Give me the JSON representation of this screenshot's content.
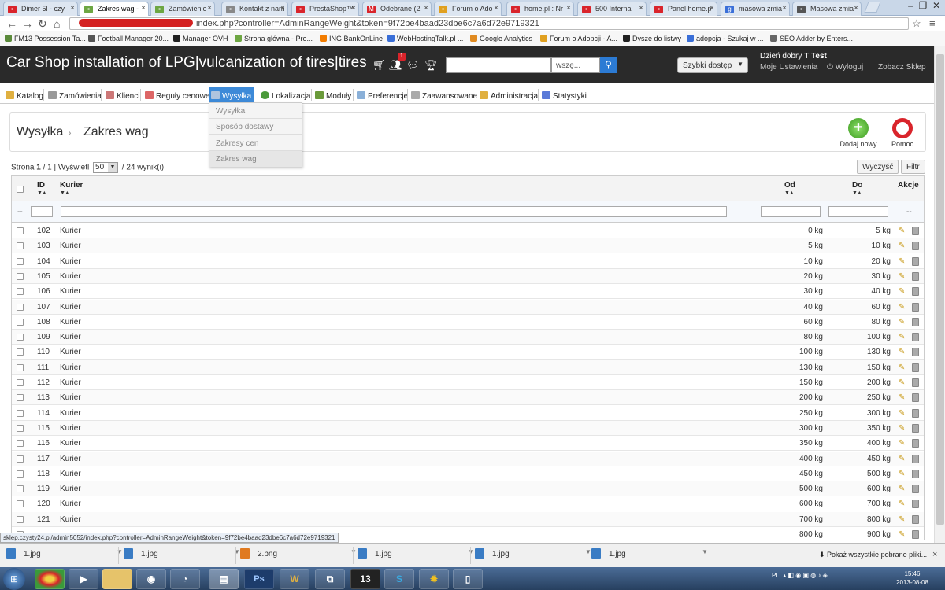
{
  "browser": {
    "tabs": [
      {
        "label": "Dimer 5l - czy",
        "color": "#d9242b"
      },
      {
        "label": "Zakres wag - ",
        "color": "#6da642"
      },
      {
        "label": "Zamówienie",
        "color": "#6da642"
      },
      {
        "label": "Kontakt z nam",
        "color": "#888888"
      },
      {
        "label": "PrestaShop™",
        "color": "#d9242b"
      },
      {
        "label": "Odebrane (2",
        "color": "#d9242b"
      },
      {
        "label": "Forum o Ado",
        "color": "#e0a020"
      },
      {
        "label": "home.pl : Nr",
        "color": "#d9242b"
      },
      {
        "label": "500 Internal",
        "color": "#d9242b"
      },
      {
        "label": "Panel home.p",
        "color": "#d9242b"
      },
      {
        "label": "masowa zmia",
        "color": "#3a6fd8"
      },
      {
        "label": "Masowa zmia",
        "color": "#555555"
      }
    ],
    "url": "index.php?controller=AdminRangeWeight&token=9f72be4baad23dbe6c7a6d72e9719321",
    "bookmarks": [
      "FM13 Possession Ta...",
      "Football Manager 20...",
      "Manager OVH",
      "Strona główna - Pre...",
      "ING BankOnLine",
      "WebHostingTalk.pl ...",
      "Google Analytics",
      "Forum o Adopcji - A...",
      "Dysze do listwy",
      "adopcja - Szukaj w ...",
      "SEO Adder by Enters..."
    ]
  },
  "header": {
    "shop_title": "Car Shop installation of LPG|vulcanization of tires|tires",
    "notification_count": "1",
    "search_placeholder": "",
    "search_scope": "wszę...",
    "quick_access": "Szybki dostęp",
    "greeting": "Dzień dobry",
    "user_name": "T Test",
    "my_settings": "Moje Ustawienia",
    "logout": "Wyloguj",
    "view_shop": "Zobacz Sklep"
  },
  "menu": {
    "items": [
      "Katalog",
      "Zamówienia",
      "Klienci",
      "Reguły cenowe",
      "Wysyłka",
      "Lokalizacja",
      "Moduły",
      "Preferencje",
      "Zaawansowane",
      "Administracja",
      "Statystyki"
    ],
    "active": "Wysyłka",
    "submenu": [
      "Wysyłka",
      "Sposób dostawy",
      "Zakresy cen",
      "Zakres wag"
    ]
  },
  "toolbar": {
    "breadcrumb_1": "Wysyłka",
    "breadcrumb_sep": "›",
    "breadcrumb_2": "Zakres wag",
    "add_new": "Dodaj nowy",
    "help": "Pomoc"
  },
  "pager": {
    "page_label": "Strona",
    "page": "1",
    "total_pages": "1",
    "show_label": "Wyświetl",
    "per_page": "50",
    "results": "/ 24 wynik(i)",
    "clear": "Wyczyść",
    "filter": "Filtr"
  },
  "grid": {
    "columns": {
      "id": "ID",
      "carrier": "Kurier",
      "from": "Od",
      "to": "Do",
      "actions": "Akcje"
    },
    "filter_dash": "--",
    "rows": [
      {
        "id": "102",
        "carrier": "Kurier",
        "from": "0 kg",
        "to": "5 kg"
      },
      {
        "id": "103",
        "carrier": "Kurier",
        "from": "5 kg",
        "to": "10 kg"
      },
      {
        "id": "104",
        "carrier": "Kurier",
        "from": "10 kg",
        "to": "20 kg"
      },
      {
        "id": "105",
        "carrier": "Kurier",
        "from": "20 kg",
        "to": "30 kg"
      },
      {
        "id": "106",
        "carrier": "Kurier",
        "from": "30 kg",
        "to": "40 kg"
      },
      {
        "id": "107",
        "carrier": "Kurier",
        "from": "40 kg",
        "to": "60 kg"
      },
      {
        "id": "108",
        "carrier": "Kurier",
        "from": "60 kg",
        "to": "80 kg"
      },
      {
        "id": "109",
        "carrier": "Kurier",
        "from": "80 kg",
        "to": "100 kg"
      },
      {
        "id": "110",
        "carrier": "Kurier",
        "from": "100 kg",
        "to": "130 kg"
      },
      {
        "id": "111",
        "carrier": "Kurier",
        "from": "130 kg",
        "to": "150 kg"
      },
      {
        "id": "112",
        "carrier": "Kurier",
        "from": "150 kg",
        "to": "200 kg"
      },
      {
        "id": "113",
        "carrier": "Kurier",
        "from": "200 kg",
        "to": "250 kg"
      },
      {
        "id": "114",
        "carrier": "Kurier",
        "from": "250 kg",
        "to": "300 kg"
      },
      {
        "id": "115",
        "carrier": "Kurier",
        "from": "300 kg",
        "to": "350 kg"
      },
      {
        "id": "116",
        "carrier": "Kurier",
        "from": "350 kg",
        "to": "400 kg"
      },
      {
        "id": "117",
        "carrier": "Kurier",
        "from": "400 kg",
        "to": "450 kg"
      },
      {
        "id": "118",
        "carrier": "Kurier",
        "from": "450 kg",
        "to": "500 kg"
      },
      {
        "id": "119",
        "carrier": "Kurier",
        "from": "500 kg",
        "to": "600 kg"
      },
      {
        "id": "120",
        "carrier": "Kurier",
        "from": "600 kg",
        "to": "700 kg"
      },
      {
        "id": "121",
        "carrier": "Kurier",
        "from": "700 kg",
        "to": "800 kg"
      },
      {
        "id": "",
        "carrier": "",
        "from": "800 kg",
        "to": "900 kg"
      }
    ]
  },
  "status_url": "sklep.czysty24.pl/admin5052/index.php?controller=AdminRangeWeight&token=9f72be4baad23dbe6c7a6d72e9719321",
  "downloads": {
    "items": [
      "1.jpg",
      "1.jpg",
      "2.png",
      "1.jpg",
      "1.jpg",
      "1.jpg"
    ],
    "show_all": "Pokaż wszystkie pobrane pliki..."
  },
  "taskbar": {
    "apps": [
      "chrome",
      "media-player",
      "explorer",
      "steam",
      "app",
      "notepad",
      "photoshop",
      "warcraft",
      "network",
      "13",
      "skype",
      "sun",
      "document"
    ],
    "locale": "PL",
    "time": "15:46",
    "date": "2013-08-08"
  },
  "colors": {
    "header_bg": "#2a2a2a",
    "menu_active": "#3d8ad8",
    "search_button": "#2c7bd4",
    "alert": "#d9242b"
  }
}
